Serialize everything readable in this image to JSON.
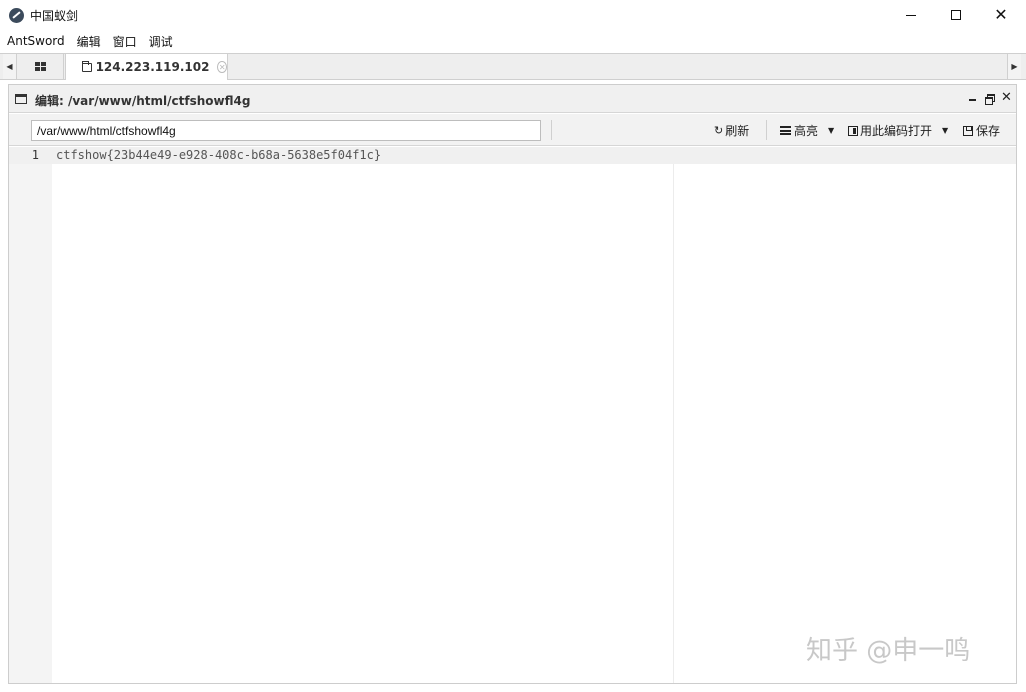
{
  "window": {
    "title": "中国蚁剑"
  },
  "menubar": {
    "items": [
      "AntSword",
      "编辑",
      "窗口",
      "调试"
    ]
  },
  "tabs": {
    "active_label": "124.223.119.102"
  },
  "panel": {
    "title": "编辑: /var/www/html/ctfshowfl4g"
  },
  "toolbar": {
    "path_value": "/var/www/html/ctfshowfl4g",
    "refresh_label": "刷新",
    "highlight_label": "高亮",
    "encoding_label": "用此编码打开",
    "save_label": "保存"
  },
  "editor": {
    "lines": [
      {
        "number": "1",
        "text": "ctfshow{23b44e49-e928-408c-b68a-5638e5f04f1c}"
      }
    ]
  },
  "watermark": {
    "text": "知乎 @申一鸣"
  }
}
